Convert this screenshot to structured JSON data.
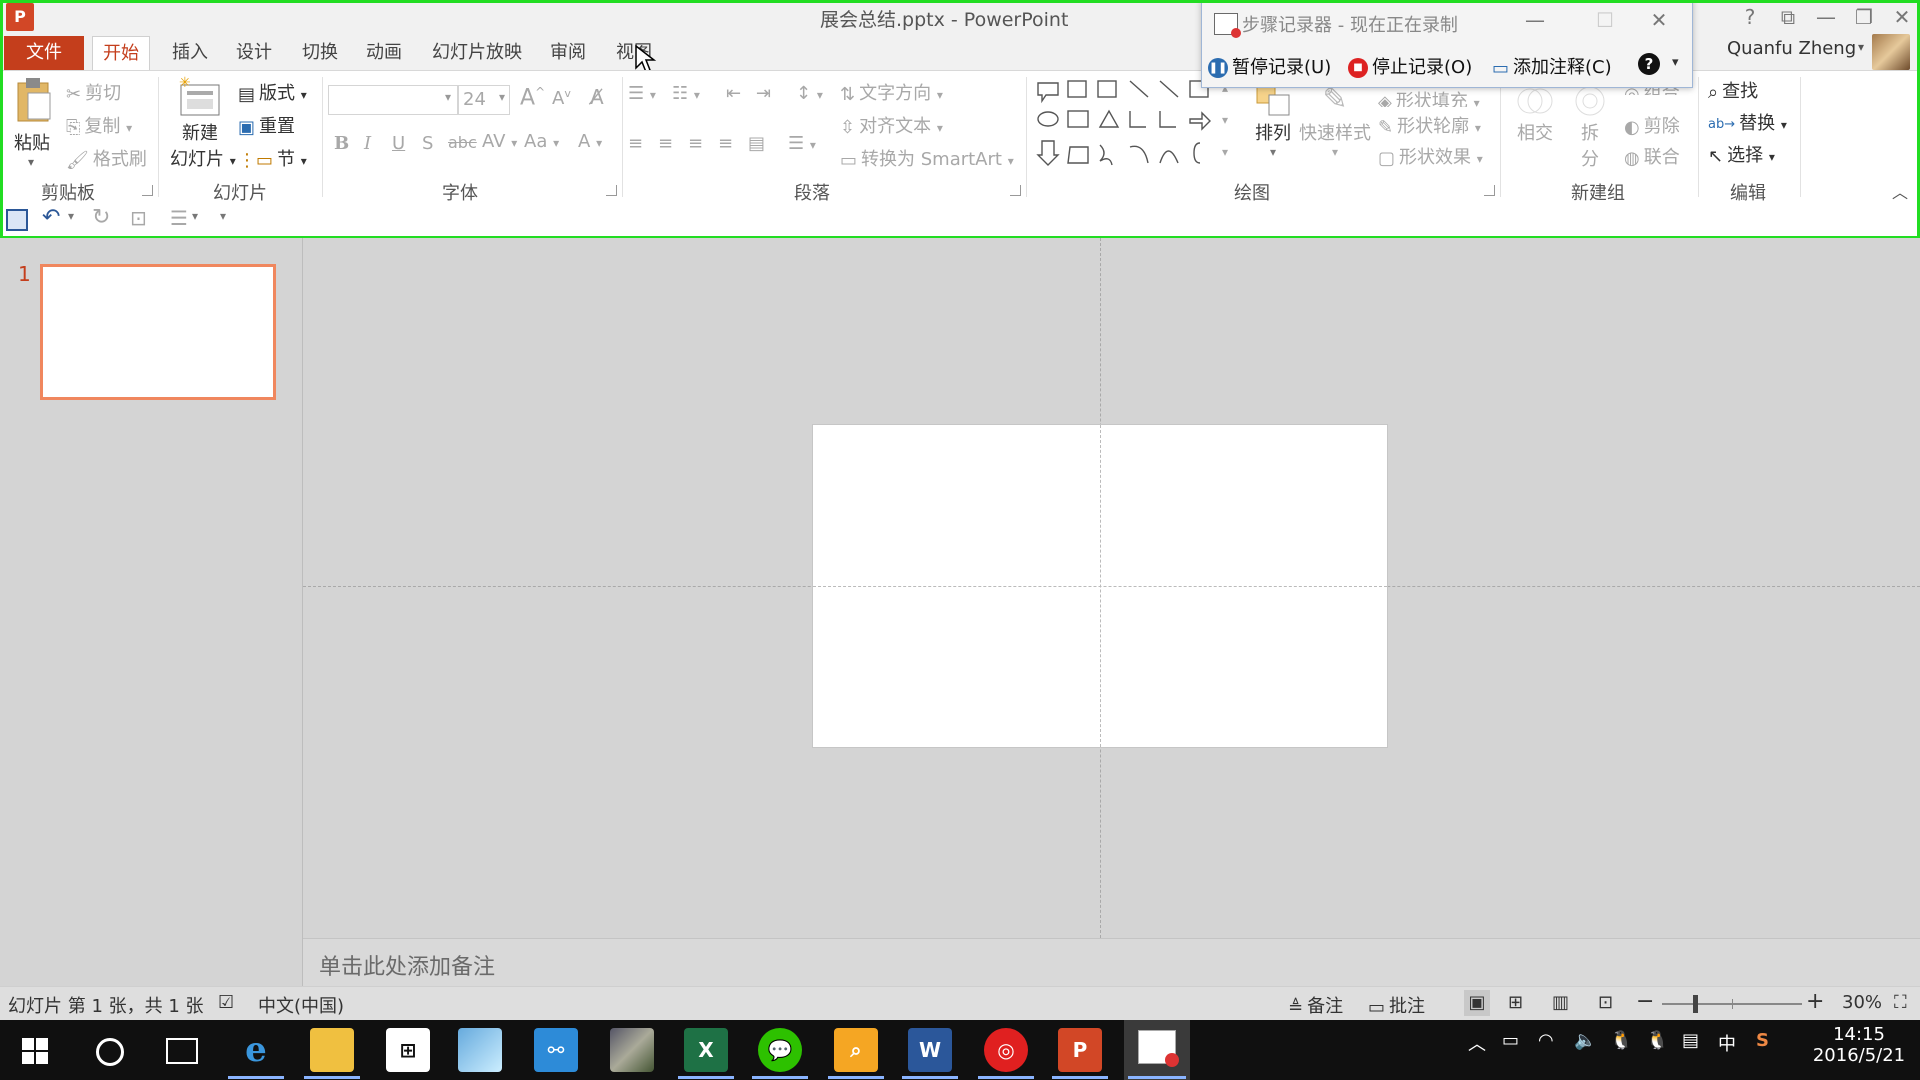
{
  "window": {
    "doc_title": "展会总结.pptx - PowerPoint",
    "app_icon_letter": "P"
  },
  "tabs": [
    "文件",
    "开始",
    "插入",
    "设计",
    "切换",
    "动画",
    "幻灯片放映",
    "审阅",
    "视图"
  ],
  "user": {
    "name": "Quanfu Zheng"
  },
  "ribbon": {
    "clipboard": {
      "label": "剪贴板",
      "paste": "粘贴",
      "cut": "剪切",
      "copy": "复制",
      "format_painter": "格式刷"
    },
    "slides": {
      "label": "幻灯片",
      "new_slide_line1": "新建",
      "new_slide_line2": "幻灯片",
      "layout": "版式",
      "reset": "重置",
      "section": "节"
    },
    "font": {
      "label": "字体",
      "font_size": "24",
      "bold": "B",
      "italic": "I",
      "underline": "U",
      "shadow": "S",
      "strike": "abc",
      "spacing": "AV",
      "case": "Aa",
      "color": "A"
    },
    "paragraph": {
      "label": "段落",
      "text_direction": "文字方向",
      "align_text": "对齐文本",
      "convert_smartart": "转换为 SmartArt"
    },
    "drawing": {
      "label": "绘图",
      "arrange": "排列",
      "quick_styles": "快速样式",
      "shape_fill": "形状填充",
      "shape_outline": "形状轮廓",
      "shape_effects": "形状效果"
    },
    "new_group": {
      "label": "新建组",
      "intersect": "相交",
      "fragment_1": "拆",
      "fragment_2": "分",
      "combine": "组合",
      "subtract": "剪除",
      "union": "联合"
    },
    "editing": {
      "label": "编辑",
      "find": "查找",
      "replace": "替换",
      "select": "选择"
    }
  },
  "recorder": {
    "title": "步骤记录器 - 现在正在录制",
    "pause": "暂停记录(U)",
    "stop": "停止记录(O)",
    "add_comment": "添加注释(C)"
  },
  "thumbnails": [
    {
      "number": "1"
    }
  ],
  "notes_placeholder": "单击此处添加备注",
  "status": {
    "slide_info": "幻灯片 第 1 张，共 1 张",
    "language": "中文(中国)",
    "notes": "备注",
    "comments": "批注",
    "zoom": "30%",
    "zoom_fraction": 0.3
  },
  "taskbar": {
    "time": "14:15",
    "date": "2016/5/21",
    "ime": "中"
  },
  "colors": {
    "accent": "#c43e1c",
    "recording_frame": "#22dd22",
    "thumb_border": "#f0875e"
  }
}
